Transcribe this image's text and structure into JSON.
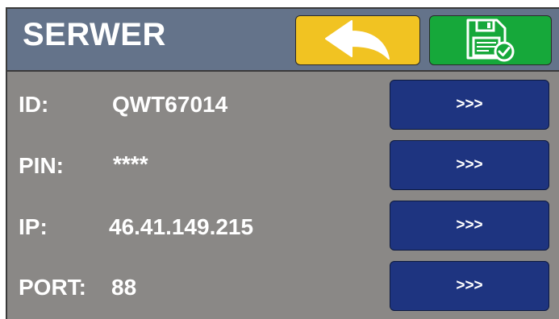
{
  "header": {
    "title": "SERWER"
  },
  "buttons": {
    "back_icon": "back-arrow-icon",
    "save_icon": "floppy-disk-check-icon"
  },
  "settings": [
    {
      "label": "ID:",
      "value": "QWT67014",
      "action": ">>>"
    },
    {
      "label": "PIN:",
      "value": "****",
      "action": ">>>"
    },
    {
      "label": "IP:",
      "value": "46.41.149.215",
      "action": ">>>"
    },
    {
      "label": "PORT:",
      "value": "88",
      "action": ">>>"
    }
  ],
  "colors": {
    "header_bg": "#64738a",
    "panel_bg": "#8a8886",
    "back_button": "#f1c322",
    "save_button": "#16a83a",
    "edit_button": "#1e3480"
  }
}
